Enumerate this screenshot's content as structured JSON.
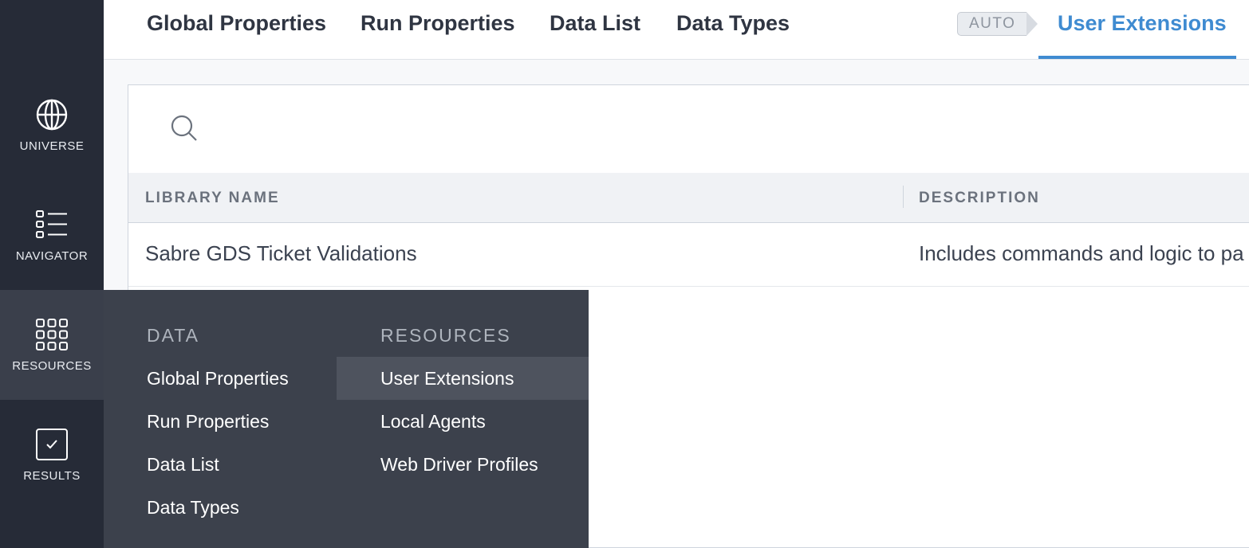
{
  "sidebar": {
    "items": [
      {
        "label": "UNIVERSE",
        "icon": "globe-icon"
      },
      {
        "label": "NAVIGATOR",
        "icon": "checklist-icon"
      },
      {
        "label": "RESOURCES",
        "icon": "grid-icon",
        "active": true
      },
      {
        "label": "RESULTS",
        "icon": "checkbox-icon"
      }
    ]
  },
  "tabs": {
    "items": [
      "Global Properties",
      "Run Properties",
      "Data List",
      "Data Types",
      "User Extensions"
    ],
    "active": "User Extensions",
    "auto_badge": "AUTO"
  },
  "search": {
    "value": "",
    "placeholder": ""
  },
  "table": {
    "columns": [
      "LIBRARY NAME",
      "DESCRIPTION"
    ],
    "rows": [
      [
        "Sabre GDS Ticket Validations",
        "Includes commands and logic to pa"
      ]
    ]
  },
  "dropdown": {
    "data_heading": "DATA",
    "data_items": [
      "Global Properties",
      "Run Properties",
      "Data List",
      "Data Types"
    ],
    "resources_heading": "RESOURCES",
    "resources_items": [
      "User Extensions",
      "Local Agents",
      "Web Driver Profiles"
    ],
    "selected": "User Extensions"
  },
  "colors": {
    "sidebar_bg": "#262b37",
    "dropdown_bg": "#3c414c",
    "accent": "#3f8bd1"
  }
}
